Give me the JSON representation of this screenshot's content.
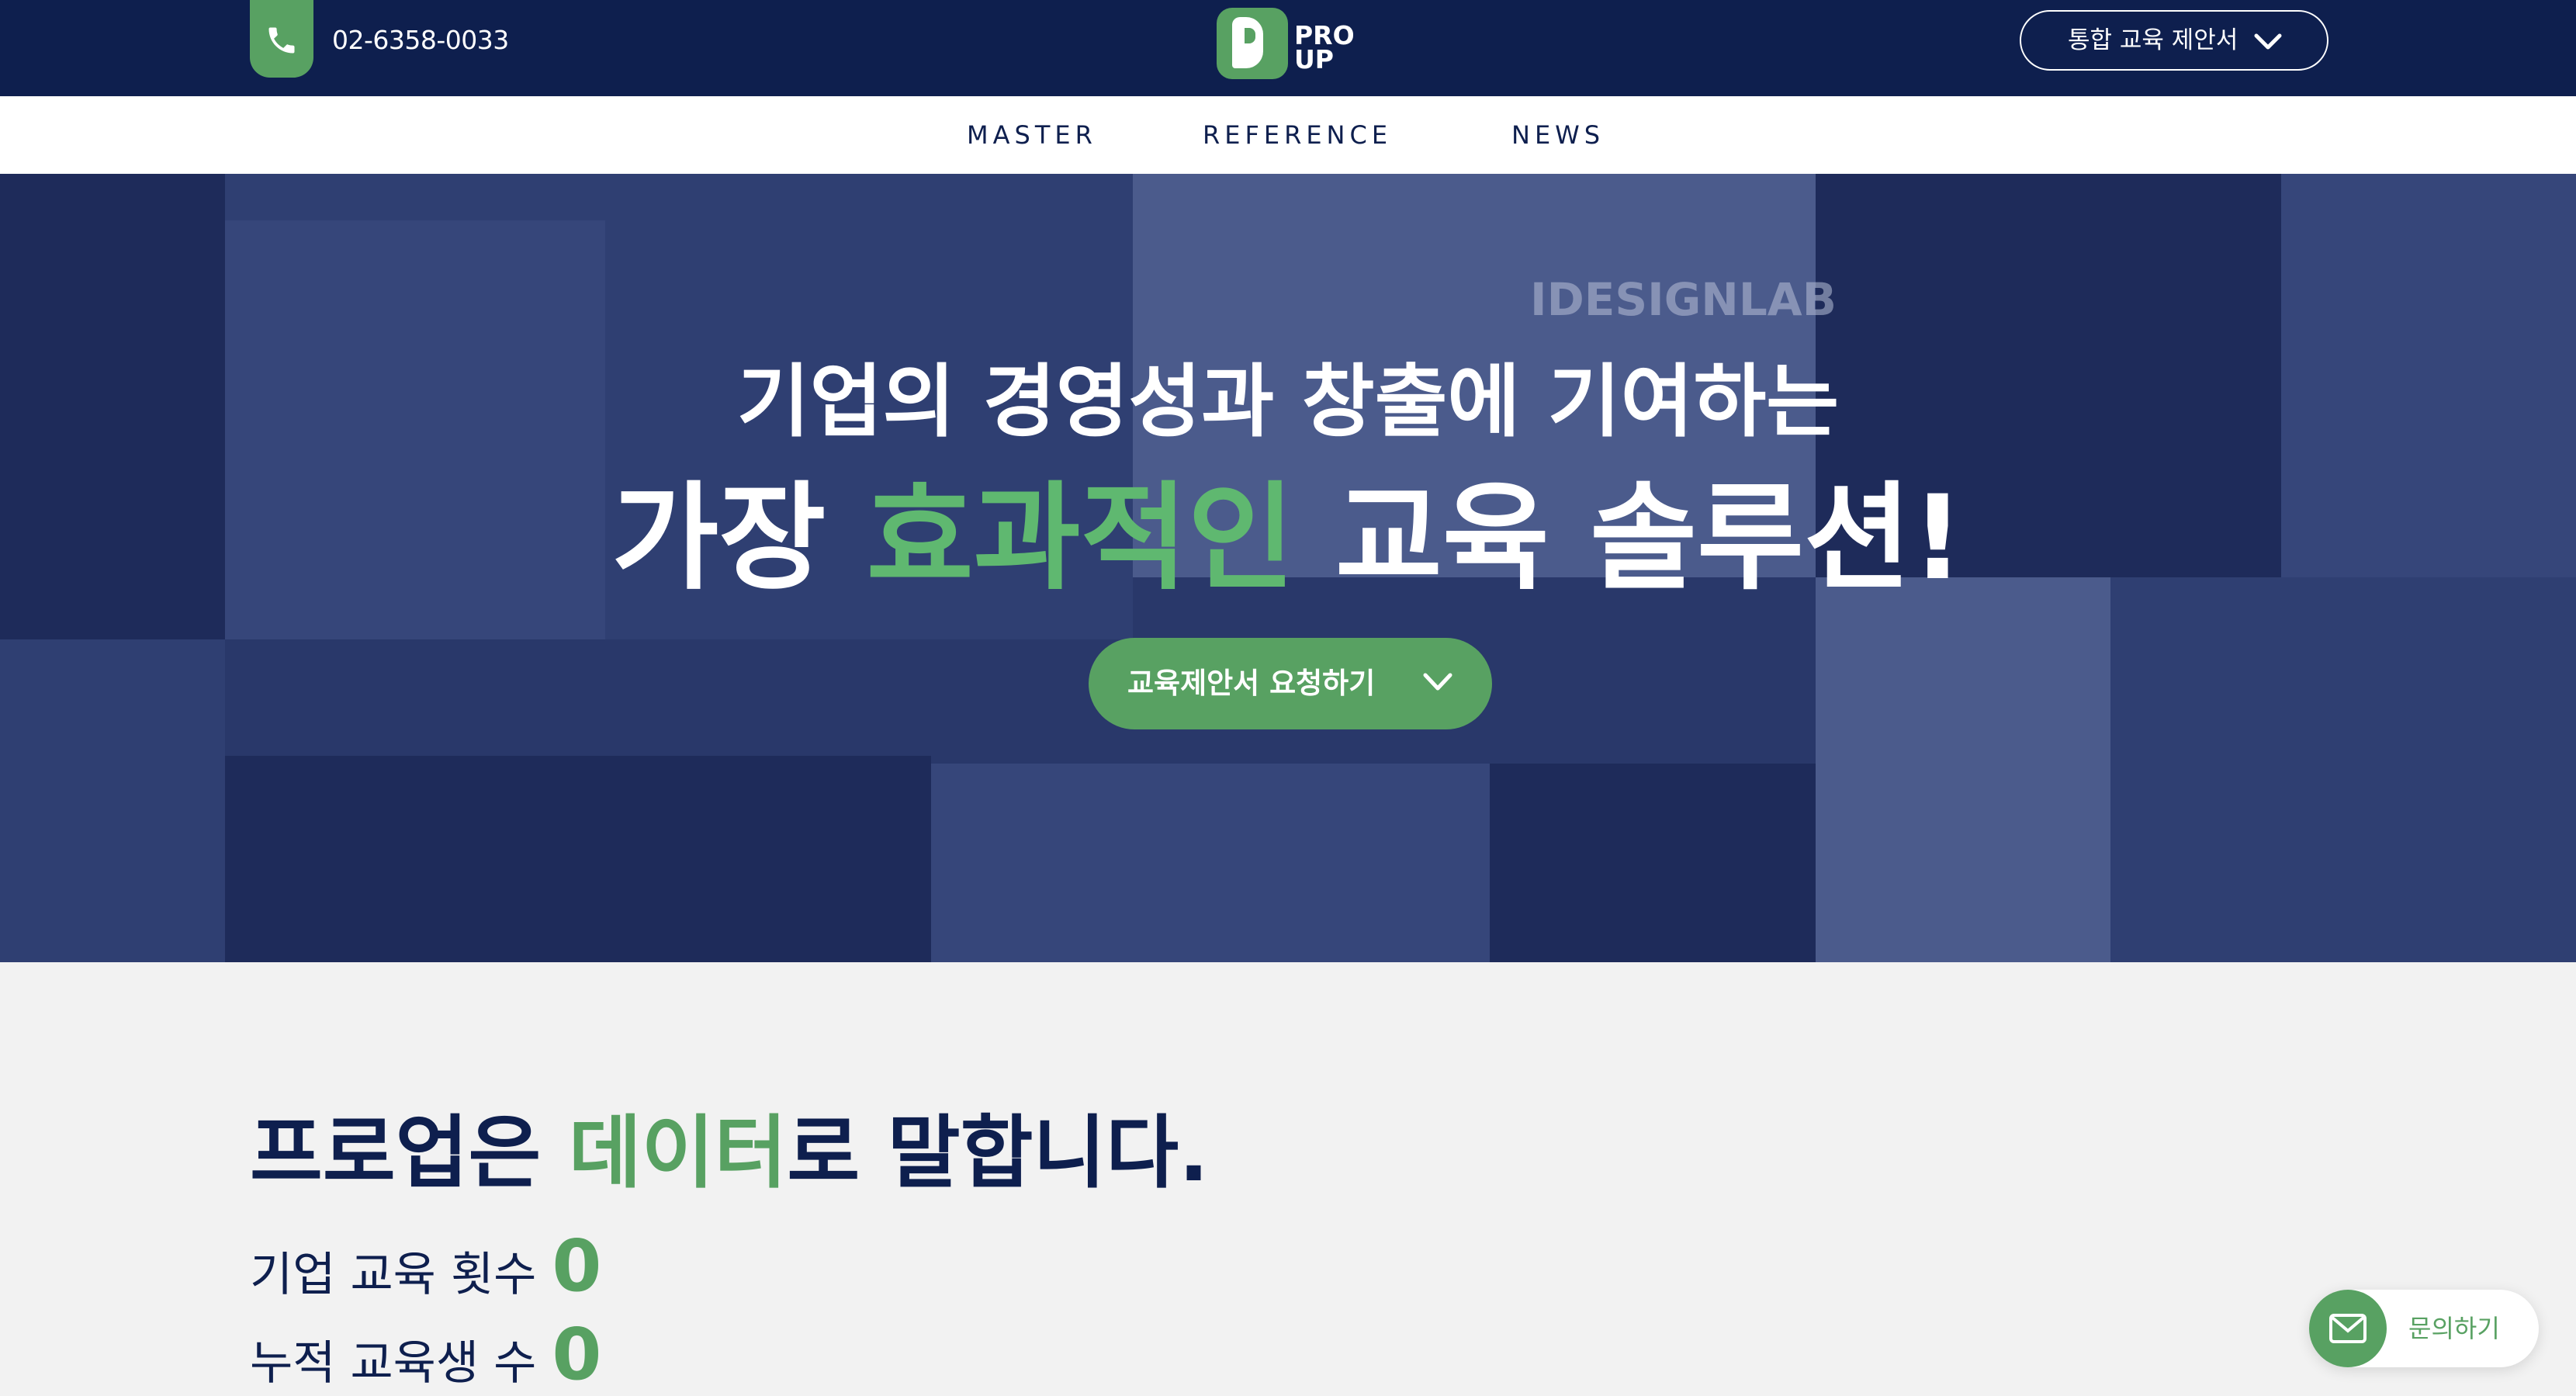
{
  "header": {
    "phone": "02-6358-0033",
    "logo": {
      "line1": "PRO",
      "line2": "UP"
    },
    "proposal_button": "통합 교육 제안서",
    "colors": {
      "navy": "#0e1f4e",
      "green": "#58a162"
    }
  },
  "nav": {
    "items": [
      {
        "label": "MASTER"
      },
      {
        "label": "REFERENCE"
      },
      {
        "label": "NEWS"
      }
    ]
  },
  "hero": {
    "background_text": "IDESIGNLAB",
    "line1": "기업의 경영성과 창출에 기여하는",
    "line2_a": "가장 ",
    "line2_highlight": "효과적인",
    "line2_b": " 교육 솔루션!",
    "cta": "교육제안서 요청하기"
  },
  "data_section": {
    "title_a": "프로업은 ",
    "title_highlight": "데이터",
    "title_b": "로 말합니다.",
    "stats": [
      {
        "label": "기업 교육 횟수",
        "value": "0"
      },
      {
        "label": "누적 교육생 수",
        "value": "0"
      }
    ]
  },
  "contact_button": {
    "label": "문의하기"
  }
}
